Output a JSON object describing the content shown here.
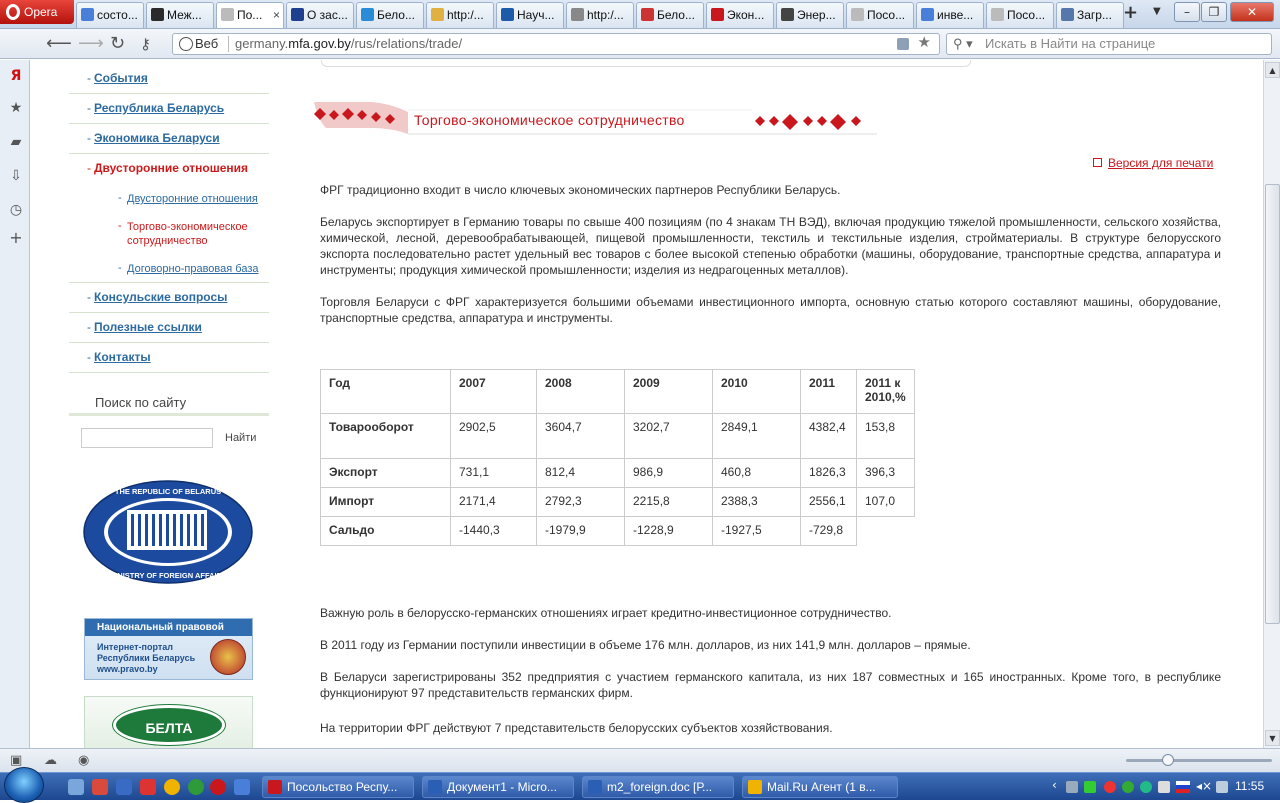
{
  "browser": {
    "menu_label": "Opera",
    "tabs": [
      {
        "label": "состо...",
        "color": "#4a7fd9"
      },
      {
        "label": "Меж...",
        "color": "#2b2b2b"
      },
      {
        "label": "По...",
        "color": "#bbbbbb",
        "active": true
      },
      {
        "label": "О зас...",
        "color": "#1f3f8f"
      },
      {
        "label": "Бело...",
        "color": "#2a8bd6"
      },
      {
        "label": "http:/...",
        "color": "#e0b040"
      },
      {
        "label": "Науч...",
        "color": "#1d5aa8"
      },
      {
        "label": "http:/...",
        "color": "#888888"
      },
      {
        "label": "Бело...",
        "color": "#cc3333"
      },
      {
        "label": "Экон...",
        "color": "#c8171d"
      },
      {
        "label": "Энер...",
        "color": "#444444"
      },
      {
        "label": "Посо...",
        "color": "#bbbbbb"
      },
      {
        "label": "инве...",
        "color": "#4a7fd9"
      },
      {
        "label": "Посо...",
        "color": "#bbbbbb"
      },
      {
        "label": "Загр...",
        "color": "#5577aa"
      }
    ],
    "close_glyph": "×",
    "new_tab": "+",
    "address": {
      "web_label": "Веб",
      "url_prefix": "germany.",
      "url_domain": "mfa.gov.by",
      "url_path": "/rus/relations/trade/"
    },
    "search_placeholder": "Искать в Найти на странице"
  },
  "sidebar_menu": {
    "items": [
      {
        "label": "События"
      },
      {
        "label": "Республика Беларусь"
      },
      {
        "label": "Экономика Беларуси"
      },
      {
        "label": "Двусторонние отношения",
        "active": true
      }
    ],
    "subitems": [
      {
        "label": "Двусторонние отношения"
      },
      {
        "label": "Торгово-экономическое сотрудничество",
        "active": true
      },
      {
        "label": "Договорно-правовая база"
      }
    ],
    "items_after": [
      {
        "label": "Консульские вопросы"
      },
      {
        "label": "Полезные ссылки"
      },
      {
        "label": "Контакты"
      }
    ]
  },
  "site_search": {
    "title": "Поиск по сайту",
    "button": "Найти"
  },
  "emblem": {
    "top_text": "THE REPUBLIC OF BELARUS",
    "bottom_text": "MINISTRY OF FOREIGN AFFAIRS"
  },
  "banners": {
    "pravo_header": "Национальный правовой",
    "pravo_line1": "Интернет-портал",
    "pravo_line2": "Республики Беларусь",
    "pravo_line3": "www.pravo.by",
    "belta": "БЕЛТА"
  },
  "main": {
    "section_title": "Торгово-экономическое сотрудничество",
    "print_link": "Версия для печати",
    "paragraphs": {
      "p1": "ФРГ традиционно входит в число ключевых экономических партнеров Республики Беларусь.",
      "p2": "Беларусь экспортирует в Германию товары по свыше 400 позициям (по 4 знакам ТН ВЭД), включая продукцию тяжелой промышленности, сельского хозяйства, химической, лесной, деревообрабатывающей, пищевой промышленности, текстиль и текстильные изделия, стройматериалы. В структуре белорусского экспорта последовательно растет удельный вес товаров с более высокой степенью обработки (машины, оборудование, транспортные средства, аппаратура и инструменты; продукция химической промышленности; изделия из недрагоценных металлов).",
      "p3": "Торговля Беларуси с ФРГ характеризуется большими объемами инвестиционного импорта, основную статью которого составляют машины, оборудование, транспортные средства, аппаратура и инструменты.",
      "p4": "Важную роль в белорусско-германских отношениях играет кредитно-инвестиционное сотрудничество.",
      "p5": "В 2011 году из Германии поступили инвестиции в объеме 176 млн. долларов, из них 141,9 млн. долларов – прямые.",
      "p6": "В Беларуси зарегистрированы 352 предприятия с участием германского капитала, из них 187 совместных и 165 иностранных. Кроме того, в республике функционируют 97 представительств германских фирм.",
      "p7": "На территории ФРГ действуют 7 представительств белорусских субъектов хозяйствования."
    },
    "table": {
      "header": [
        "Год",
        "2007",
        "2008",
        "2009",
        "2010",
        "2011",
        "2011 к 2010,%"
      ],
      "rows": [
        [
          "Товарооборот",
          "2902,5",
          "3604,7",
          "3202,7",
          "2849,1",
          "4382,4",
          "153,8"
        ],
        [
          "Экспорт",
          "731,1",
          "812,4",
          "986,9",
          "460,8",
          "1826,3",
          "396,3"
        ],
        [
          "Импорт",
          "2171,4",
          "2792,3",
          "2215,8",
          "2388,3",
          "2556,1",
          "107,0"
        ],
        [
          "Сальдо",
          "-1440,3",
          "-1979,9",
          "-1228,9",
          "-1927,5",
          "-729,8"
        ]
      ]
    }
  },
  "taskbar": {
    "items": [
      {
        "label": "Посольство Респу...",
        "color": "#c8171d"
      },
      {
        "label": "Документ1 - Micro...",
        "color": "#2b5fb3"
      },
      {
        "label": "m2_foreign.doc [Р...",
        "color": "#2b5fb3"
      },
      {
        "label": "Mail.Ru Агент (1 в...",
        "color": "#f0b400"
      }
    ],
    "clock": "11:55"
  }
}
